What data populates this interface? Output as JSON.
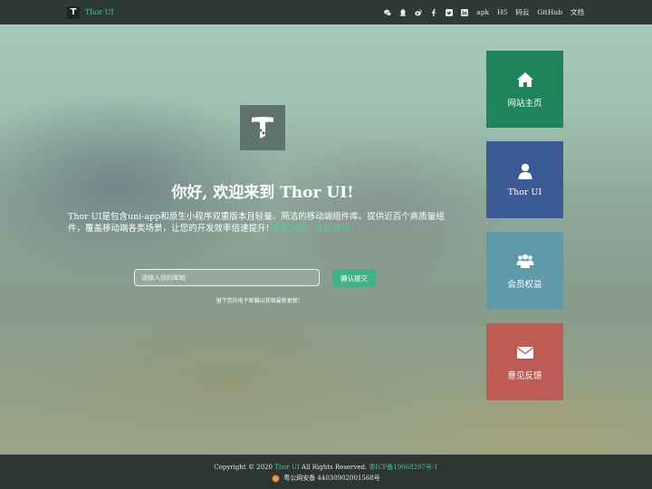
{
  "header": {
    "brand_logo": "T",
    "brand_name": "Thor UI",
    "nav_icons": [
      "wechat-icon",
      "qq-icon",
      "weibo-icon",
      "facebook-icon",
      "twitter-icon",
      "linkedin-icon"
    ],
    "nav_links": [
      "apk",
      "H5",
      "码云",
      "GitHub",
      "文档"
    ]
  },
  "hero": {
    "title_prefix": "你好, 欢迎来到 ",
    "title_brand": "Thor UI",
    "title_suffix": "!",
    "description": "Thor UI是包含uni-app和原生小程序双重版本且轻量、简洁的移动端组件库。提供近百个高质量组件，覆盖移动端各类场景，让您的开发效率倍速提升! ",
    "link_docs": "查看文档",
    "link_separator": "，",
    "link_start": "立即使用"
  },
  "subscribe": {
    "placeholder": "请输入你的邮箱",
    "button_label": "确认提交",
    "hint": "留下您的电子邮箱以获取最新更新!"
  },
  "tiles": [
    {
      "label": "网站主页",
      "icon": "home-icon",
      "color": "#1f8459"
    },
    {
      "label": "Thor UI",
      "icon": "user-icon",
      "color": "#3c5a94"
    },
    {
      "label": "会员权益",
      "icon": "users-icon",
      "color": "#5f9aab"
    },
    {
      "label": "意见反馈",
      "icon": "envelope-icon",
      "color": "#bd5c54"
    }
  ],
  "footer": {
    "copyright_prefix": "Copyright © 2020 ",
    "copyright_brand": "Thor UI",
    "copyright_suffix": " All Rights Reserved. ",
    "icp": "粤ICP备19068297号-1",
    "police": "粤公网安备 44030902001568号"
  },
  "colors": {
    "accent": "#3fb386",
    "link": "#4cc39a",
    "topbar": "#2d3a35"
  }
}
